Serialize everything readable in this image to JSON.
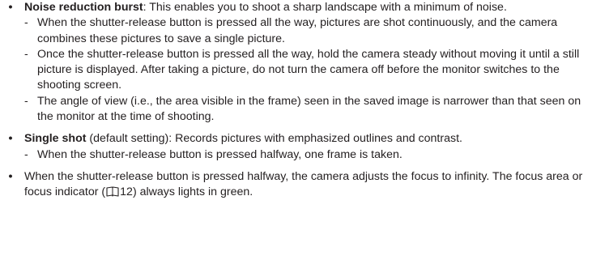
{
  "section1": {
    "term": "Noise reduction burst",
    "description": ": This enables you to shoot a sharp landscape with a minimum of noise.",
    "notes": [
      "When the shutter-release button is pressed all the way, pictures are shot continuously, and the camera combines these pictures to save a single picture.",
      "Once the shutter-release button is pressed all the way, hold the camera steady without moving it until a still picture is displayed. After taking a picture, do not turn the camera off before the monitor switches to the shooting screen.",
      "The angle of view (i.e., the area visible in the frame) seen in the saved image is narrower than that seen on the monitor at the time of shooting."
    ]
  },
  "section2": {
    "term": "Single shot",
    "description": " (default setting): Records pictures with emphasized outlines and contrast.",
    "notes": [
      "When the shutter-release button is pressed halfway, one frame is taken."
    ]
  },
  "section3": {
    "text_before": "When the shutter-release button is pressed halfway, the camera adjusts the focus to infinity. The focus area or focus indicator (",
    "page_ref": "12",
    "text_after": ") always lights in green."
  },
  "bullet_symbol": "•",
  "dash_symbol": "-"
}
